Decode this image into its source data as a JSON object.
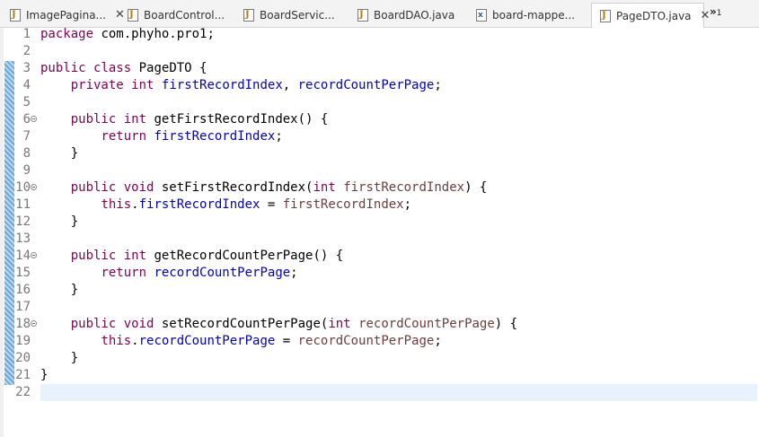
{
  "tabs": [
    {
      "label": "ImagePagina...",
      "icon": "java-file-icon",
      "active": false,
      "has_close": true
    },
    {
      "label": "BoardControl...",
      "icon": "java-file-icon",
      "active": false,
      "has_close": false
    },
    {
      "label": "BoardServic...",
      "icon": "java-file-icon",
      "active": false,
      "has_close": false
    },
    {
      "label": "BoardDAO.java",
      "icon": "java-file-icon",
      "active": false,
      "has_close": false
    },
    {
      "label": "board-mappe...",
      "icon": "xml-file-icon",
      "active": false,
      "has_close": false
    },
    {
      "label": "PageDTO.java",
      "icon": "java-file-icon",
      "active": true,
      "has_close": true
    }
  ],
  "overflow": {
    "symbol": "»",
    "count": "1"
  },
  "colors": {
    "keyword": "#7f0055",
    "field": "#0000c0",
    "parameter": "#6a3e3e",
    "current_line": "#e8f2fe",
    "line_number": "#787878"
  },
  "lines": [
    {
      "n": "1",
      "tokens": [
        {
          "t": "package",
          "c": "kw"
        },
        {
          "t": " com.phyho.pro1;"
        }
      ]
    },
    {
      "n": "2",
      "tokens": []
    },
    {
      "n": "3",
      "tokens": [
        {
          "t": "public",
          "c": "kw"
        },
        {
          "t": " "
        },
        {
          "t": "class",
          "c": "kw"
        },
        {
          "t": " PageDTO {"
        }
      ]
    },
    {
      "n": "4",
      "tokens": [
        {
          "t": "    "
        },
        {
          "t": "private",
          "c": "kw"
        },
        {
          "t": " "
        },
        {
          "t": "int",
          "c": "kw"
        },
        {
          "t": " "
        },
        {
          "t": "firstRecordIndex",
          "c": "fd"
        },
        {
          "t": ", "
        },
        {
          "t": "recordCountPerPage",
          "c": "fd"
        },
        {
          "t": ";"
        }
      ]
    },
    {
      "n": "5",
      "tokens": []
    },
    {
      "n": "6",
      "fold": true,
      "tokens": [
        {
          "t": "    "
        },
        {
          "t": "public",
          "c": "kw"
        },
        {
          "t": " "
        },
        {
          "t": "int",
          "c": "kw"
        },
        {
          "t": " getFirstRecordIndex() {"
        }
      ]
    },
    {
      "n": "7",
      "tokens": [
        {
          "t": "        "
        },
        {
          "t": "return",
          "c": "kw"
        },
        {
          "t": " "
        },
        {
          "t": "firstRecordIndex",
          "c": "fd"
        },
        {
          "t": ";"
        }
      ]
    },
    {
      "n": "8",
      "tokens": [
        {
          "t": "    }"
        }
      ]
    },
    {
      "n": "9",
      "tokens": []
    },
    {
      "n": "10",
      "fold": true,
      "tokens": [
        {
          "t": "    "
        },
        {
          "t": "public",
          "c": "kw"
        },
        {
          "t": " "
        },
        {
          "t": "void",
          "c": "kw"
        },
        {
          "t": " setFirstRecordIndex("
        },
        {
          "t": "int",
          "c": "kw"
        },
        {
          "t": " "
        },
        {
          "t": "firstRecordIndex",
          "c": "pm"
        },
        {
          "t": ") {"
        }
      ]
    },
    {
      "n": "11",
      "tokens": [
        {
          "t": "        "
        },
        {
          "t": "this",
          "c": "kw"
        },
        {
          "t": "."
        },
        {
          "t": "firstRecordIndex",
          "c": "fd"
        },
        {
          "t": " = "
        },
        {
          "t": "firstRecordIndex",
          "c": "pm"
        },
        {
          "t": ";"
        }
      ]
    },
    {
      "n": "12",
      "tokens": [
        {
          "t": "    }"
        }
      ]
    },
    {
      "n": "13",
      "tokens": []
    },
    {
      "n": "14",
      "fold": true,
      "tokens": [
        {
          "t": "    "
        },
        {
          "t": "public",
          "c": "kw"
        },
        {
          "t": " "
        },
        {
          "t": "int",
          "c": "kw"
        },
        {
          "t": " getRecordCountPerPage() {"
        }
      ]
    },
    {
      "n": "15",
      "tokens": [
        {
          "t": "        "
        },
        {
          "t": "return",
          "c": "kw"
        },
        {
          "t": " "
        },
        {
          "t": "recordCountPerPage",
          "c": "fd"
        },
        {
          "t": ";"
        }
      ]
    },
    {
      "n": "16",
      "tokens": [
        {
          "t": "    }"
        }
      ]
    },
    {
      "n": "17",
      "tokens": []
    },
    {
      "n": "18",
      "fold": true,
      "tokens": [
        {
          "t": "    "
        },
        {
          "t": "public",
          "c": "kw"
        },
        {
          "t": " "
        },
        {
          "t": "void",
          "c": "kw"
        },
        {
          "t": " setRecordCountPerPage("
        },
        {
          "t": "int",
          "c": "kw"
        },
        {
          "t": " "
        },
        {
          "t": "recordCountPerPage",
          "c": "pm"
        },
        {
          "t": ") {"
        }
      ]
    },
    {
      "n": "19",
      "tokens": [
        {
          "t": "        "
        },
        {
          "t": "this",
          "c": "kw"
        },
        {
          "t": "."
        },
        {
          "t": "recordCountPerPage",
          "c": "fd"
        },
        {
          "t": " = "
        },
        {
          "t": "recordCountPerPage",
          "c": "pm"
        },
        {
          "t": ";"
        }
      ]
    },
    {
      "n": "20",
      "tokens": [
        {
          "t": "    }"
        }
      ]
    },
    {
      "n": "21",
      "tokens": [
        {
          "t": "}"
        }
      ]
    },
    {
      "n": "22",
      "current": true,
      "tokens": []
    }
  ]
}
